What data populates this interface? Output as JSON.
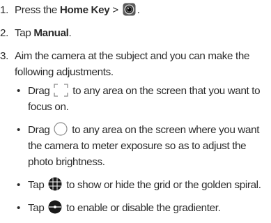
{
  "steps": [
    {
      "number": "1.",
      "prefix": "Press the ",
      "bold": "Home Key",
      "separator": " > ",
      "icon": "camera-app-icon",
      "suffix": "."
    },
    {
      "number": "2.",
      "prefix": "Tap ",
      "bold": "Manual",
      "suffix": "."
    },
    {
      "number": "3.",
      "text": "Aim the camera at the subject and you can make the following adjustments."
    }
  ],
  "bullets": [
    {
      "dot": "•",
      "before": "Drag ",
      "icon": "focus-frame-icon",
      "after": " to any area on the screen that you want to focus on."
    },
    {
      "dot": "•",
      "before": "Drag ",
      "icon": "exposure-circle-icon",
      "after": " to any area on the screen where you want the camera to meter exposure so as to adjust the photo brightness."
    },
    {
      "dot": "•",
      "before": "Tap ",
      "icon": "grid-icon",
      "after": " to show or hide the grid or the golden spiral."
    },
    {
      "dot": "•",
      "before": "Tap ",
      "icon": "gradienter-icon",
      "after": " to enable or disable the gradienter."
    }
  ]
}
